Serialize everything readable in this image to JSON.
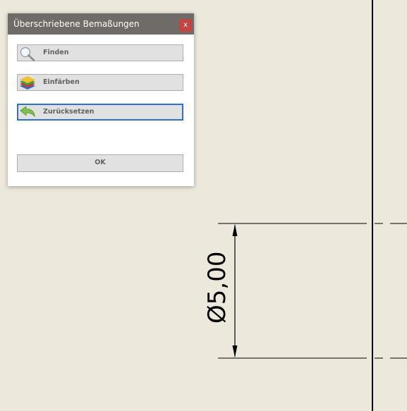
{
  "dialog": {
    "title": "Überschriebene Bemaßungen",
    "close_label": "x",
    "buttons": {
      "find": {
        "label": "Finden",
        "icon": "magnifier-icon"
      },
      "colorize": {
        "label": "Einfärben",
        "icon": "layers-icon"
      },
      "reset": {
        "label": "Zurücksetzen",
        "icon": "undo-arrow-icon"
      }
    },
    "ok_label": "OK"
  },
  "drawing": {
    "dimension_text": "Ø5,00"
  },
  "colors": {
    "canvas_background": "#ece9dc",
    "titlebar": "#6f6b69",
    "close_button": "#c4453f",
    "focus_border": "#2f72c4"
  }
}
